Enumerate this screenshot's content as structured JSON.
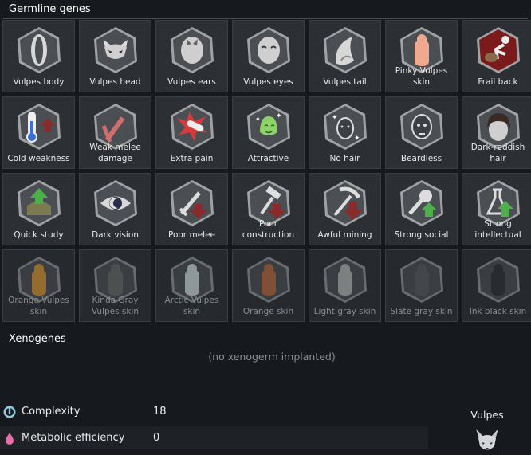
{
  "header": {
    "title": "Germline genes"
  },
  "genes": [
    {
      "label": "Vulpes body",
      "icon": "body-icon",
      "active": true
    },
    {
      "label": "Vulpes head",
      "icon": "fox-head-icon",
      "active": true
    },
    {
      "label": "Vulpes ears",
      "icon": "ears-icon",
      "active": true
    },
    {
      "label": "Vulpes eyes",
      "icon": "eyes-icon",
      "active": true
    },
    {
      "label": "Vulpes tail",
      "icon": "tail-icon",
      "active": true
    },
    {
      "label": "Pinky Vulpes skin",
      "icon": "skin-pink-icon",
      "active": true
    },
    {
      "label": "Frail back",
      "icon": "frail-back-icon",
      "active": true
    },
    {
      "label": "Cold weakness",
      "icon": "thermometer-icon",
      "active": true
    },
    {
      "label": "Weak melee damage",
      "icon": "weak-melee-icon",
      "active": true
    },
    {
      "label": "Extra pain",
      "icon": "pain-icon",
      "active": true
    },
    {
      "label": "Attractive",
      "icon": "attractive-icon",
      "active": true
    },
    {
      "label": "No hair",
      "icon": "no-hair-icon",
      "active": true
    },
    {
      "label": "Beardless",
      "icon": "beardless-icon",
      "active": true
    },
    {
      "label": "Dark-reddish hair",
      "icon": "hair-icon",
      "active": true
    },
    {
      "label": "Quick study",
      "icon": "quick-study-icon",
      "active": true
    },
    {
      "label": "Dark vision",
      "icon": "eye-icon",
      "active": true
    },
    {
      "label": "Poor melee",
      "icon": "sword-icon",
      "active": true
    },
    {
      "label": "Poor construction",
      "icon": "hammer-icon",
      "active": true
    },
    {
      "label": "Awful mining",
      "icon": "pickaxe-icon",
      "active": true
    },
    {
      "label": "Strong social",
      "icon": "microphone-icon",
      "active": true
    },
    {
      "label": "Strong intellectual",
      "icon": "flask-icon",
      "active": true
    },
    {
      "label": "Orange Vulpes skin",
      "icon": "skin-orange-icon",
      "active": false
    },
    {
      "label": "Kinda Gray Vulpes skin",
      "icon": "skin-gray-icon",
      "active": false
    },
    {
      "label": "Arctic Vulpes skin",
      "icon": "skin-arctic-icon",
      "active": false
    },
    {
      "label": "Orange skin",
      "icon": "skin-orange-dark-icon",
      "active": false
    },
    {
      "label": "Light gray skin",
      "icon": "skin-lightgray-icon",
      "active": false
    },
    {
      "label": "Slate gray skin",
      "icon": "skin-slate-icon",
      "active": false
    },
    {
      "label": "Ink black skin",
      "icon": "skin-black-icon",
      "active": false
    }
  ],
  "xenogenes": {
    "title": "Xenogenes",
    "empty_text": "(no xenogerm implanted)"
  },
  "stats": [
    {
      "label": "Complexity",
      "value": "18",
      "icon": "complexity-icon",
      "color": "#8ec9dc"
    },
    {
      "label": "Metabolic efficiency",
      "value": "0",
      "icon": "metabolism-icon",
      "color": "#e86fa8"
    }
  ],
  "xenotype": {
    "name": "Vulpes",
    "icon": "fox-head-icon"
  },
  "colors": {
    "background": "#16191d",
    "card": "#2c3034",
    "hex_bg": "#2b2f33"
  }
}
